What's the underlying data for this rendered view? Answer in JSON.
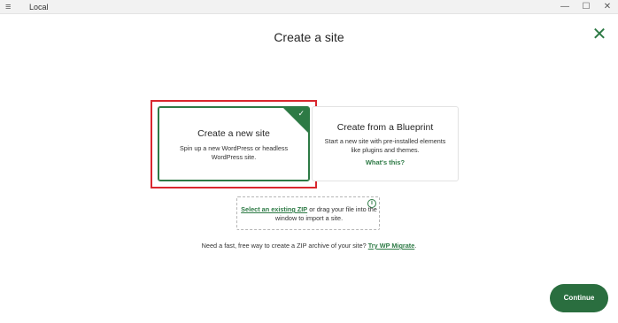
{
  "titlebar": {
    "menu_icon": "hamburger-menu-icon",
    "app_name": "Local",
    "minimize_glyph": "—",
    "maximize_glyph": "☐",
    "close_glyph": "✕"
  },
  "page": {
    "title": "Create a site",
    "close_glyph": "✕"
  },
  "options": {
    "new_site": {
      "title": "Create a new site",
      "description": "Spin up a new WordPress or headless WordPress site.",
      "selected": true,
      "check_glyph": "✓"
    },
    "blueprint": {
      "title": "Create from a Blueprint",
      "description": "Start a new site with pre-installed elements like plugins and themes.",
      "link": "What's this?"
    }
  },
  "zip": {
    "link": "Select an existing ZIP",
    "text": " or drag your file into the window to import a site.",
    "info_glyph": "i"
  },
  "bottom": {
    "text": "Need a fast, free way to create a ZIP archive of your site? ",
    "link": "Try WP Migrate",
    "end": "."
  },
  "actions": {
    "continue_label": "Continue"
  },
  "colors": {
    "accent": "#2d7a45",
    "highlight": "#d9272e"
  }
}
